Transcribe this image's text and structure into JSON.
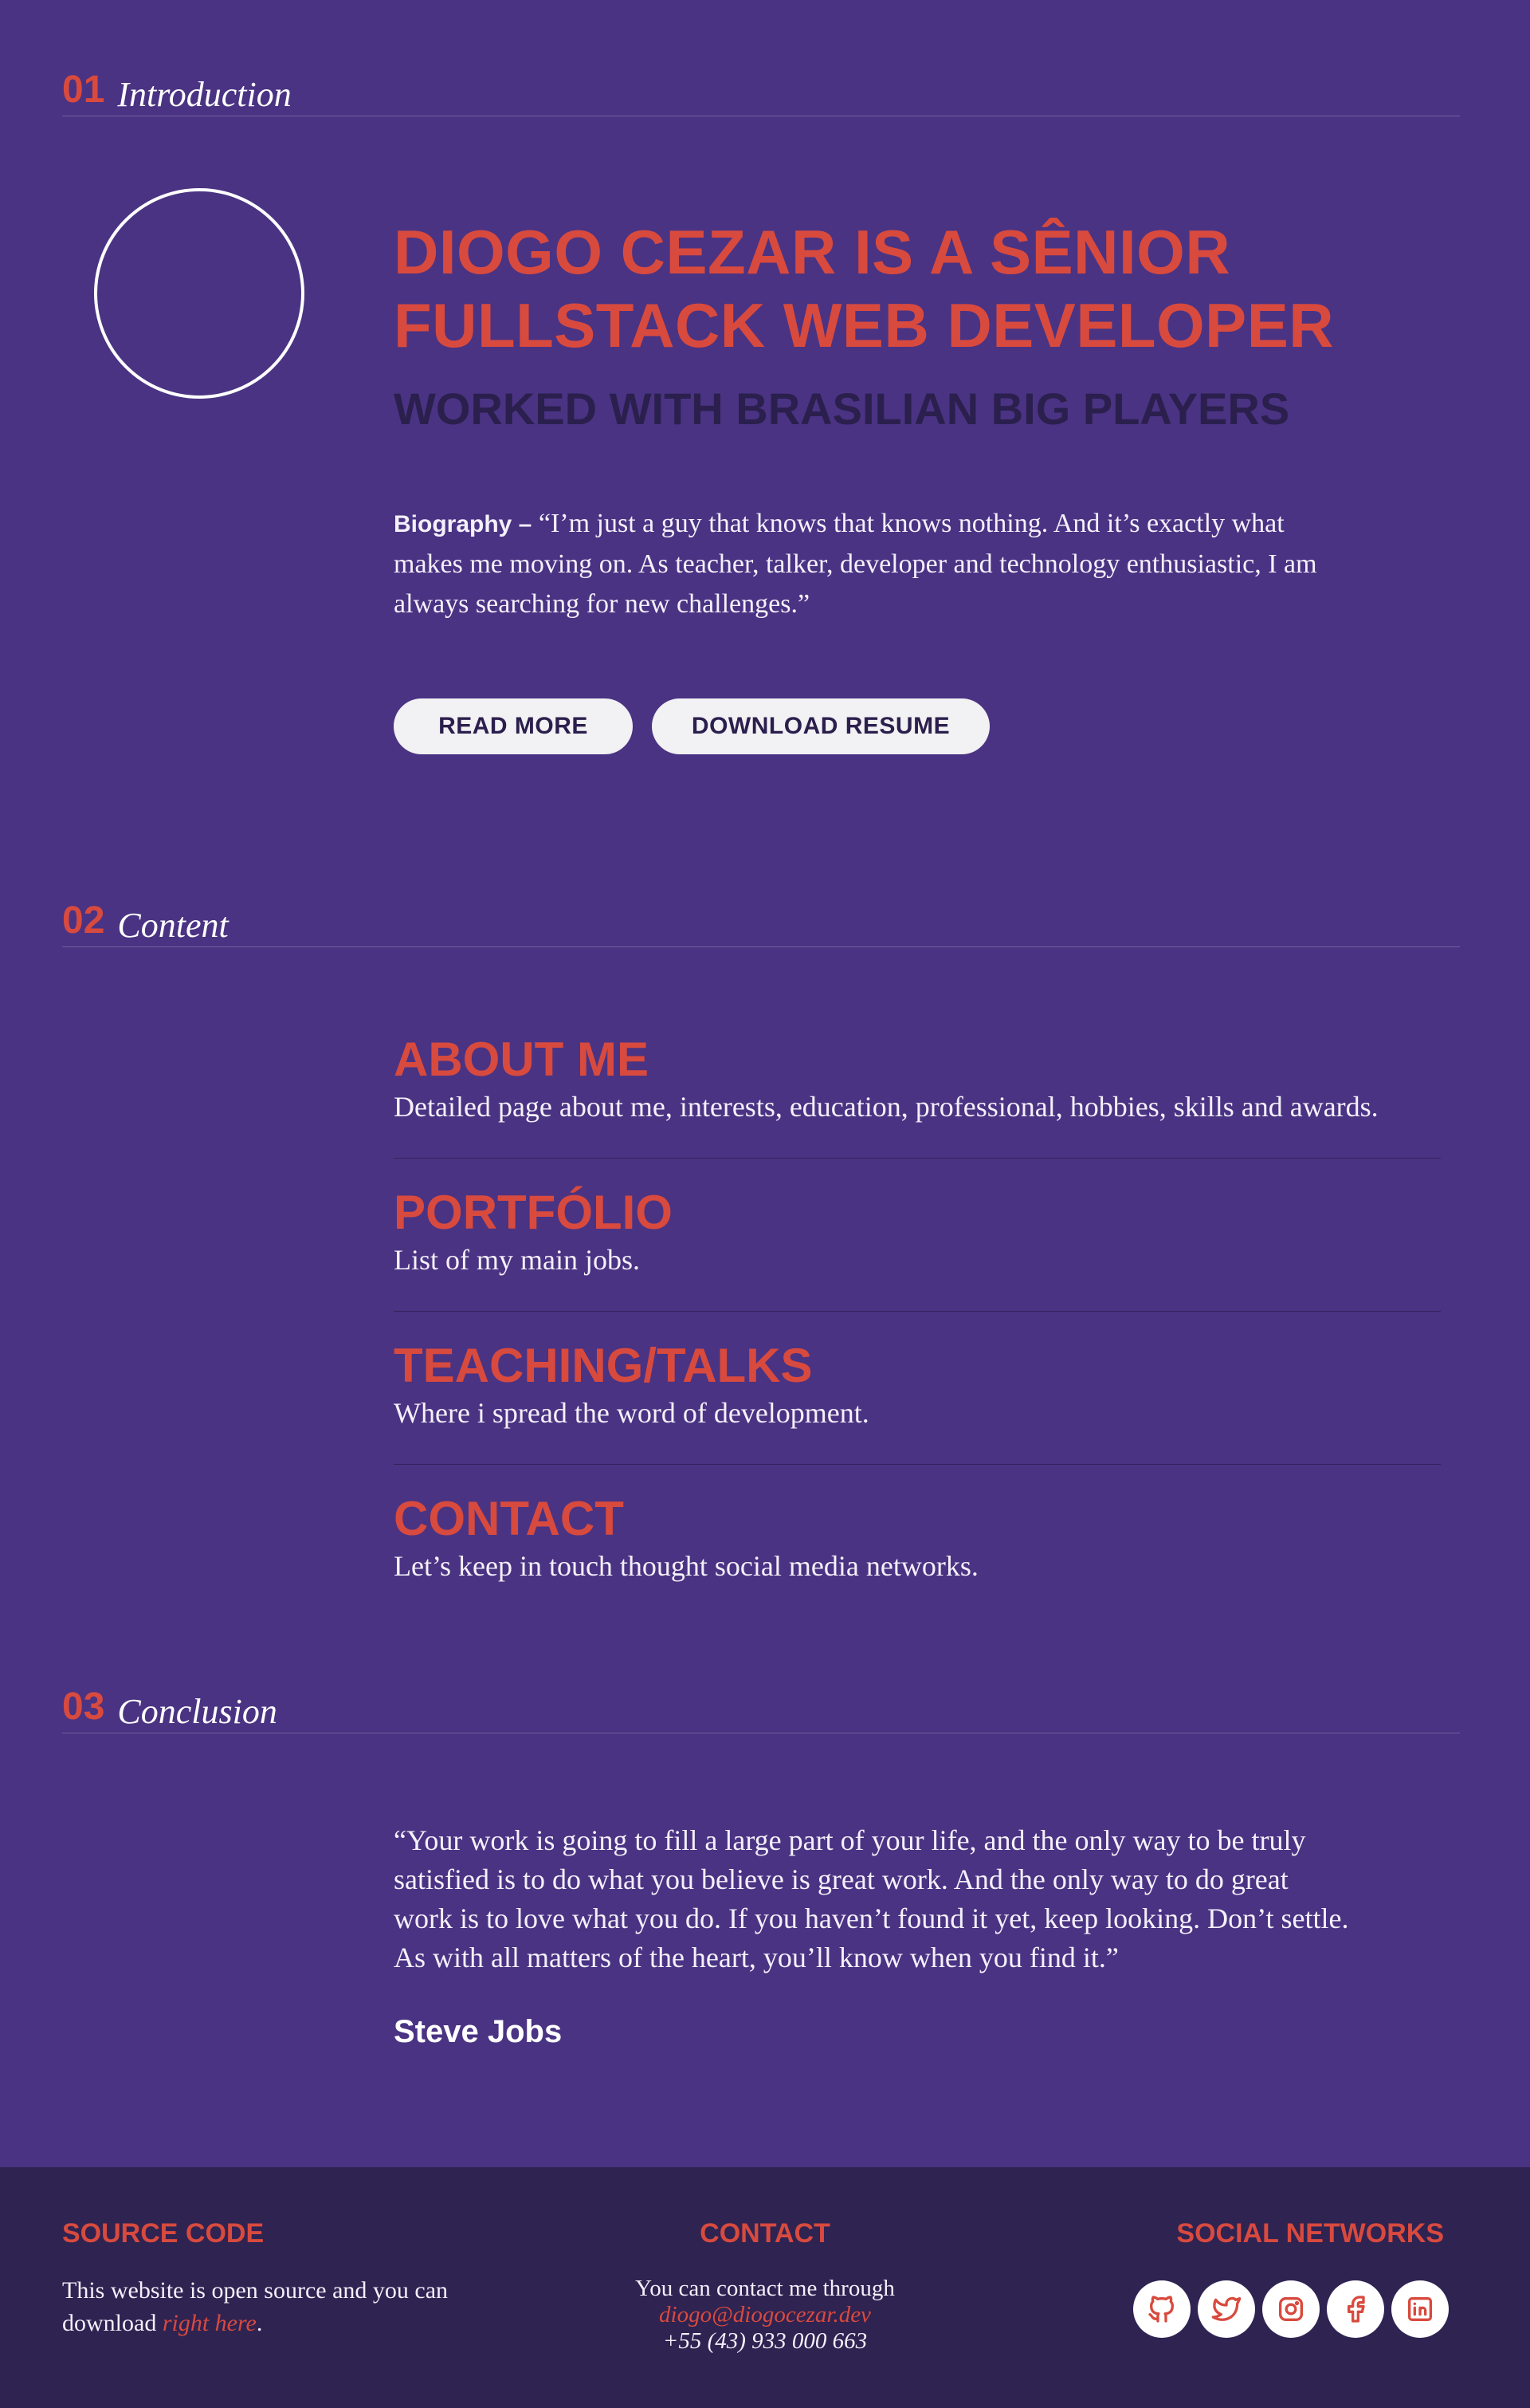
{
  "sections": [
    {
      "num": "01",
      "title": "Introduction"
    },
    {
      "num": "02",
      "title": "Content"
    },
    {
      "num": "03",
      "title": "Conclusion"
    }
  ],
  "intro": {
    "headline": "DIOGO CEZAR IS A SÊNIOR FULLSTACK WEB DEVELOPER",
    "subheadline": "WORKED WITH BRASILIAN BIG PLAYERS",
    "bio_label": "Biography –",
    "bio_text": "“I’m just a guy that knows that knows nothing. And it’s exactly what makes me moving on. As teacher, talker, developer and technology enthusiastic, I am always searching for new challenges.”",
    "buttons": {
      "read_more": "READ MORE",
      "download_resume": "DOWNLOAD RESUME"
    }
  },
  "content": {
    "items": [
      {
        "title": "ABOUT ME",
        "desc": "Detailed page about me, interests, education, professional, hobbies, skills and awards."
      },
      {
        "title": "PORTFÓLIO",
        "desc": "List of my main jobs."
      },
      {
        "title": "TEACHING/TALKS",
        "desc": "Where i spread the word of development."
      },
      {
        "title": "CONTACT",
        "desc": "Let’s keep in touch thought social media networks."
      }
    ]
  },
  "conclusion": {
    "quote": "“Your work is going to fill a large part of your life, and the only way to be truly satisfied is to do what you believe is great work. And the only way to do great work is to love what you do. If you haven’t found it yet, keep looking. Don’t settle. As with all matters of the heart, you’ll know when you find it.”",
    "author": "Steve Jobs"
  },
  "footer": {
    "source": {
      "title": "SOURCE CODE",
      "text_before": "This website is open source and you can download ",
      "link": "right here",
      "text_after": "."
    },
    "contact": {
      "title": "CONTACT",
      "text": "You can contact me through",
      "email": "diogo@diogocezar.dev",
      "phone": "+55 (43) 933 000 663"
    },
    "social": {
      "title": "SOCIAL NETWORKS",
      "icons": [
        "github-icon",
        "twitter-icon",
        "instagram-icon",
        "facebook-icon",
        "linkedin-icon"
      ]
    }
  },
  "colors": {
    "background": "#4a3383",
    "accent": "#d84a3e",
    "footer": "#2f2352",
    "dark_text": "#2b1f4d"
  }
}
